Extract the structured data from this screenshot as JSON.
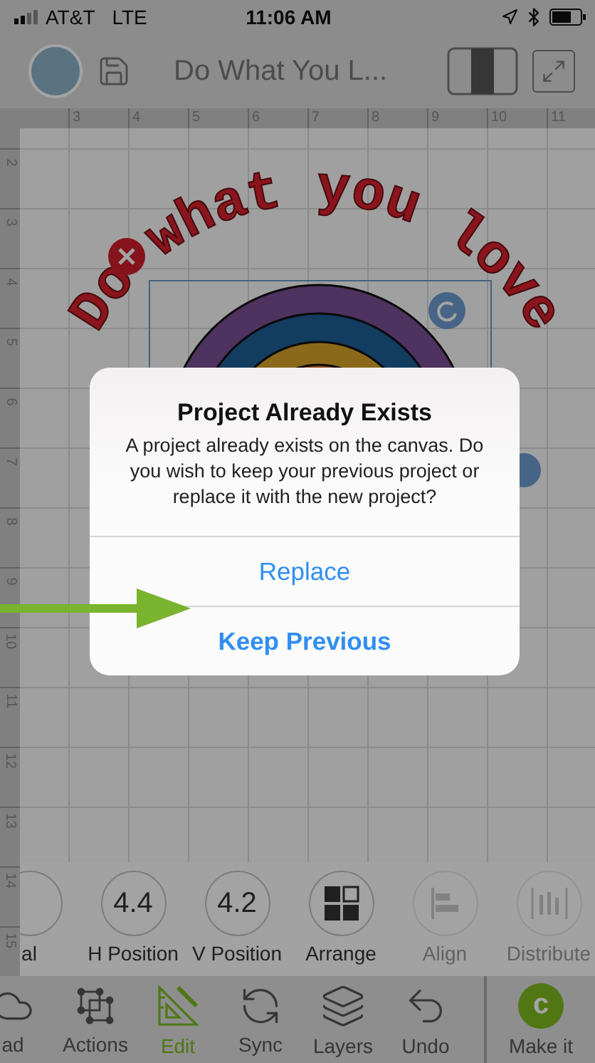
{
  "status_bar": {
    "carrier": "AT&T",
    "network": "LTE",
    "time": "11:06 AM"
  },
  "header": {
    "project_title": "Do What You L..."
  },
  "ruler": {
    "top_labels": [
      "3",
      "4",
      "5",
      "6",
      "7",
      "8",
      "9",
      "10",
      "11"
    ],
    "left_labels": [
      "2",
      "3",
      "4",
      "5",
      "6",
      "7",
      "8",
      "9",
      "10",
      "11",
      "12",
      "13",
      "14",
      "15"
    ]
  },
  "canvas": {
    "design_text": "Do what you love"
  },
  "dialog": {
    "title": "Project Already Exists",
    "message": "A project already exists on the canvas. Do you wish to keep your previous project or replace it with the new project?",
    "actions": [
      {
        "label": "Replace",
        "bold": false
      },
      {
        "label": "Keep Previous",
        "bold": true
      }
    ]
  },
  "edit_toolbar": [
    {
      "kind": "value",
      "label": "al",
      "disabled": false
    },
    {
      "kind": "value",
      "value": "4.4",
      "label": "H Position",
      "disabled": false
    },
    {
      "kind": "value",
      "value": "4.2",
      "label": "V Position",
      "disabled": false
    },
    {
      "kind": "arrange",
      "label": "Arrange",
      "disabled": false
    },
    {
      "kind": "align",
      "label": "Align",
      "disabled": true
    },
    {
      "kind": "distribute",
      "label": "Distribute",
      "disabled": true
    }
  ],
  "tab_bar": {
    "items": [
      {
        "kind": "cloud",
        "label": "ad",
        "selected": false
      },
      {
        "kind": "actions",
        "label": "Actions",
        "selected": false
      },
      {
        "kind": "edit",
        "label": "Edit",
        "selected": true
      },
      {
        "kind": "sync",
        "label": "Sync",
        "selected": false
      },
      {
        "kind": "layers",
        "label": "Layers",
        "selected": false
      },
      {
        "kind": "undo",
        "label": "Undo",
        "selected": false
      }
    ],
    "make_it": {
      "label": "Make it",
      "badge": "c"
    }
  }
}
